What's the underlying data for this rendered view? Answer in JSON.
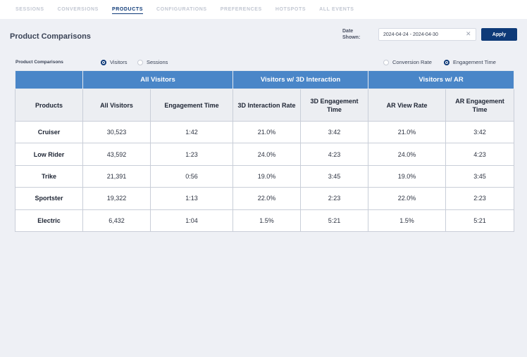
{
  "nav": {
    "tabs": [
      {
        "label": "SESSIONS",
        "active": false
      },
      {
        "label": "CONVERSIONS",
        "active": false
      },
      {
        "label": "PRODUCTS",
        "active": true
      },
      {
        "label": "CONFIGURATIONS",
        "active": false
      },
      {
        "label": "PREFERENCES",
        "active": false
      },
      {
        "label": "HOTSPOTS",
        "active": false
      },
      {
        "label": "ALL EVENTS",
        "active": false
      }
    ]
  },
  "page": {
    "title": "Product Comparisons",
    "date_label_line1": "Date",
    "date_label_line2": "Shown:",
    "date_range": "2024-04-24 - 2024-04-30",
    "clear_glyph": "✕",
    "apply_label": "Apply"
  },
  "filters": {
    "label": "Product Comparisons",
    "left": [
      {
        "label": "Visitors",
        "selected": true
      },
      {
        "label": "Sessions",
        "selected": false
      }
    ],
    "right": [
      {
        "label": "Conversion Rate",
        "selected": false
      },
      {
        "label": "Engagement Time",
        "selected": true
      }
    ]
  },
  "table": {
    "groups": [
      "All Visitors",
      "Visitors w/ 3D Interaction",
      "Visitors w/ AR"
    ],
    "columns": [
      "Products",
      "All Visitors",
      "Engagement Time",
      "3D Interaction Rate",
      "3D Engagement Time",
      "AR View Rate",
      "AR Engagement Time"
    ],
    "rows": [
      [
        "Cruiser",
        "30,523",
        "1:42",
        "21.0%",
        "3:42",
        "21.0%",
        "3:42"
      ],
      [
        "Low Rider",
        "43,592",
        "1:23",
        "24.0%",
        "4:23",
        "24.0%",
        "4:23"
      ],
      [
        "Trike",
        "21,391",
        "0:56",
        "19.0%",
        "3:45",
        "19.0%",
        "3:45"
      ],
      [
        "Sportster",
        "19,322",
        "1:13",
        "22.0%",
        "2:23",
        "22.0%",
        "2:23"
      ],
      [
        "Electric",
        "6,432",
        "1:04",
        "1.5%",
        "5:21",
        "1.5%",
        "5:21"
      ]
    ]
  },
  "colors": {
    "accent": "#0e3a78",
    "table_header": "#4a86c8",
    "background": "#eef0f5"
  }
}
